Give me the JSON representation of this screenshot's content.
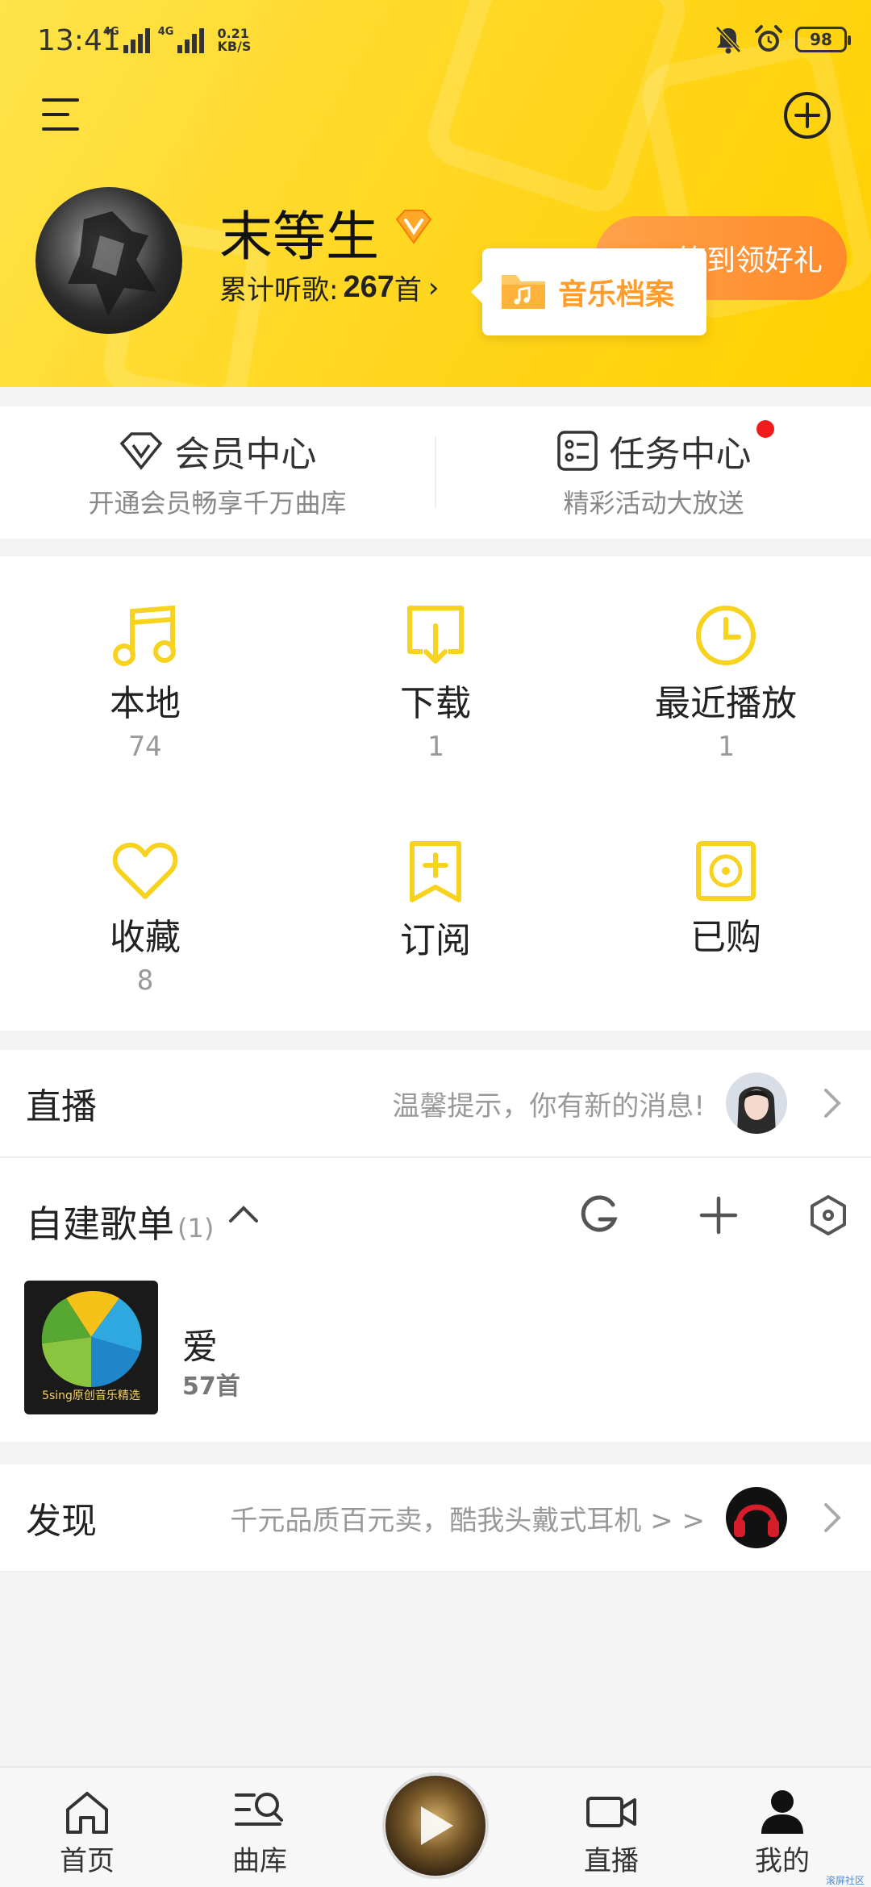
{
  "status_bar": {
    "time": "13:41",
    "net1": "4G",
    "net2": "4G",
    "speed_value": "0.21",
    "speed_unit": "KB/S",
    "battery": "98"
  },
  "profile": {
    "username": "末等生",
    "listen_prefix": "累计听歌:",
    "listen_count": "267",
    "listen_suffix": "首",
    "signin_label": "签到领好礼",
    "tooltip_label": "音乐档案"
  },
  "member": {
    "vip_title": "会员中心",
    "vip_sub": "开通会员畅享千万曲库",
    "task_title": "任务中心",
    "task_sub": "精彩活动大放送"
  },
  "grid": [
    {
      "label": "本地",
      "count": "74",
      "icon": "music-note-icon"
    },
    {
      "label": "下载",
      "count": "1",
      "icon": "download-icon"
    },
    {
      "label": "最近播放",
      "count": "1",
      "icon": "clock-icon"
    },
    {
      "label": "收藏",
      "count": "8",
      "icon": "heart-icon"
    },
    {
      "label": "订阅",
      "count": "",
      "icon": "bookmark-plus-icon"
    },
    {
      "label": "已购",
      "count": "",
      "icon": "disc-icon"
    }
  ],
  "live": {
    "title": "直播",
    "hint": "温馨提示，你有新的消息!"
  },
  "playlists": {
    "title": "自建歌单",
    "count": "(1)",
    "items": [
      {
        "name": "爱",
        "songs": "57首",
        "cover_caption": "5sing原创音乐精选"
      }
    ]
  },
  "discover": {
    "title": "发现",
    "hint": "千元品质百元卖，酷我头戴式耳机 > >"
  },
  "nav": {
    "home": "首页",
    "library": "曲库",
    "live": "直播",
    "mine": "我的"
  },
  "watermark": "滚屏社区",
  "colors": {
    "brand_yellow": "#ffd61e",
    "icon_yellow": "#f7d320",
    "accent_orange": "#ff9c2a",
    "red_dot": "#f21b1b"
  }
}
